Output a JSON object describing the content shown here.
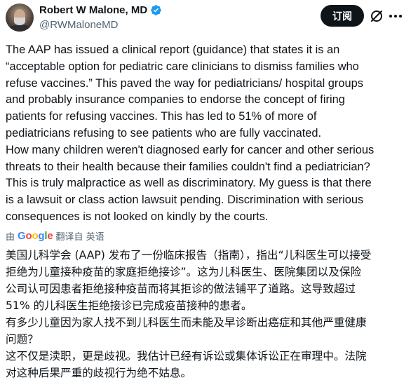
{
  "author": {
    "display_name": "Robert W Malone, MD",
    "handle": "@RWMaloneMD",
    "verified": true,
    "verified_color": "#1d9bf0"
  },
  "actions": {
    "subscribe_label": "订阅",
    "grok_icon": "grok-icon",
    "more_icon": "more-icon"
  },
  "tweet": {
    "text": "The AAP has issued a clinical report (guidance) that states it is an\n“acceptable option for pediatric care clinicians to dismiss families who\nrefuse vaccines.” This paved the way for pediatricians/ hospital groups\nand probably insurance companies to endorse the concept of firing\npatients for refusing vaccines. This has led to 51% of more of\npediatricians refusing to see patients who are fully vaccinated.\nHow many children weren't diagnosed early for cancer and other serious\nthreats to their health because their families couldn't find a pediatrician?\nThis is truly malpractice as well as discriminatory. My guess is that there\nis a lawsuit or class action lawsuit pending. Discrimination with serious\nconsequences is not looked on kindly by the courts."
  },
  "translation_bar": {
    "by_label": "由",
    "google_logo": "Google",
    "translated_from_label": "翻译自 英语"
  },
  "translation": {
    "text": "美国儿科学会 (AAP) 发布了一份临床报告（指南），指出“儿科医生可以接受\n拒绝为儿童接种疫苗的家庭拒绝接诊”。这为儿科医生、医院集团以及保险\n公司认可因患者拒绝接种疫苗而将其拒诊的做法铺平了道路。这导致超过\n51% 的儿科医生拒绝接诊已完成疫苗接种的患者。\n有多少儿童因为家人找不到儿科医生而未能及早诊断出癌症和其他严重健康\n问题？\n这不仅是渎职，更是歧视。我估计已经有诉讼或集体诉讼正在审理中。法院\n对这种后果严重的歧视行为绝不姑息。"
  },
  "colors": {
    "text_primary": "#0f1419",
    "text_secondary": "#536471",
    "button_bg": "#0f1419",
    "google_blue": "#4285f4",
    "google_red": "#ea4335",
    "google_yellow": "#fbbc05",
    "google_green": "#34a853"
  }
}
